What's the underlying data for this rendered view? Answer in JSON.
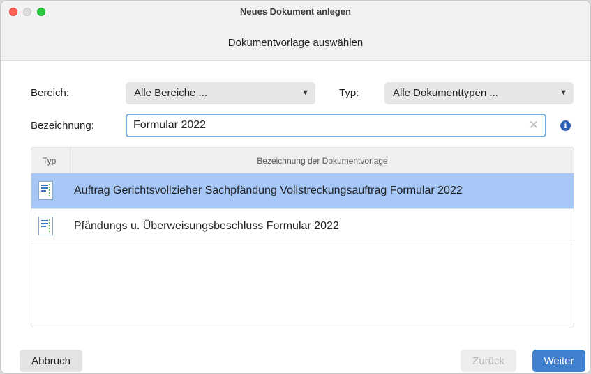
{
  "window": {
    "title": "Neues Dokument anlegen",
    "subtitle": "Dokumentvorlage auswählen"
  },
  "filters": {
    "bereich_label": "Bereich:",
    "bereich_value": "Alle Bereiche ...",
    "typ_label": "Typ:",
    "typ_value": "Alle Dokumenttypen ...",
    "bezeichnung_label": "Bezeichnung:",
    "bezeichnung_value": "Formular 2022",
    "clear_glyph": "✕",
    "info_glyph": "i",
    "dropdown_glyph": "▼"
  },
  "table": {
    "columns": [
      "Typ",
      "Bezeichnung der Dokumentvorlage"
    ],
    "rows": [
      {
        "icon": "document-icon",
        "name": "Auftrag Gerichtsvollzieher Sachpfändung Vollstreckungsauftrag Formular 2022",
        "selected": true
      },
      {
        "icon": "document-icon",
        "name": "Pfändungs u. Überweisungsbeschluss Formular 2022",
        "selected": false
      }
    ]
  },
  "buttons": {
    "cancel": "Abbruch",
    "back": "Zurück",
    "next": "Weiter"
  },
  "colors": {
    "selection": "#a7c7f6",
    "primary_button": "#3f80cf",
    "focus_border": "#7aaee6",
    "info_icon": "#2f62b5"
  }
}
